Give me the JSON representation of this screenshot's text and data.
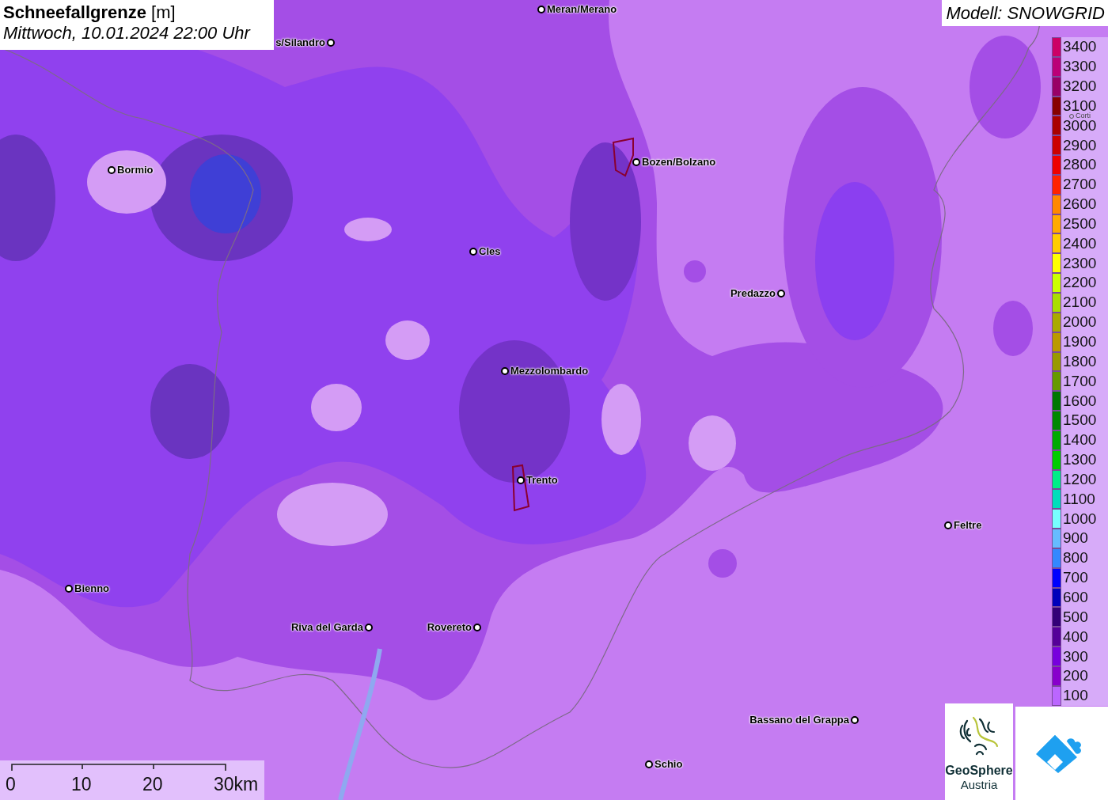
{
  "header": {
    "title": "Schneefallgrenze",
    "unit": "[m]",
    "datetime": "Mittwoch, 10.01.2024 22:00 Uhr"
  },
  "model": "Modell: SNOWGRID",
  "cities": [
    {
      "name": "Meran/Merano",
      "dimmed": false
    },
    {
      "name": "s/Silandro",
      "dimmed": false
    },
    {
      "name": "Bormio",
      "dimmed": false
    },
    {
      "name": "Bozen/Bolzano",
      "dimmed": false
    },
    {
      "name": "Cles",
      "dimmed": false
    },
    {
      "name": "Predazzo",
      "dimmed": false
    },
    {
      "name": "Mezzolombardo",
      "dimmed": false
    },
    {
      "name": "Trento",
      "dimmed": false
    },
    {
      "name": "Feltre",
      "dimmed": false
    },
    {
      "name": "Bienno",
      "dimmed": false
    },
    {
      "name": "Riva del Garda",
      "dimmed": false
    },
    {
      "name": "Rovereto",
      "dimmed": false
    },
    {
      "name": "Bassano del Grappa",
      "dimmed": false
    },
    {
      "name": "Schio",
      "dimmed": false
    },
    {
      "name": "Corti",
      "dimmed": true
    }
  ],
  "legend": [
    {
      "label": "3400",
      "color": "#cc0066"
    },
    {
      "label": "3300",
      "color": "#bb0077"
    },
    {
      "label": "3200",
      "color": "#990066"
    },
    {
      "label": "3100",
      "color": "#880000"
    },
    {
      "label": "3000",
      "color": "#aa0000"
    },
    {
      "label": "2900",
      "color": "#cc0000"
    },
    {
      "label": "2800",
      "color": "#ee0000"
    },
    {
      "label": "2700",
      "color": "#ff2200"
    },
    {
      "label": "2600",
      "color": "#ff8800"
    },
    {
      "label": "2500",
      "color": "#ffaa00"
    },
    {
      "label": "2400",
      "color": "#ffcc00"
    },
    {
      "label": "2300",
      "color": "#ffff00"
    },
    {
      "label": "2200",
      "color": "#ccff00"
    },
    {
      "label": "2100",
      "color": "#aadd00"
    },
    {
      "label": "2000",
      "color": "#aaaa00"
    },
    {
      "label": "1900",
      "color": "#bb9900"
    },
    {
      "label": "1800",
      "color": "#999900"
    },
    {
      "label": "1700",
      "color": "#669900"
    },
    {
      "label": "1600",
      "color": "#007700"
    },
    {
      "label": "1500",
      "color": "#008800"
    },
    {
      "label": "1400",
      "color": "#00aa00"
    },
    {
      "label": "1300",
      "color": "#00cc00"
    },
    {
      "label": "1200",
      "color": "#00ee88"
    },
    {
      "label": "1100",
      "color": "#00ddbb"
    },
    {
      "label": "1000",
      "color": "#77ffff"
    },
    {
      "label": "900",
      "color": "#66bbff"
    },
    {
      "label": "800",
      "color": "#3388ff"
    },
    {
      "label": "700",
      "color": "#0000ff"
    },
    {
      "label": "600",
      "color": "#0000bb"
    },
    {
      "label": "500",
      "color": "#330077"
    },
    {
      "label": "400",
      "color": "#550099"
    },
    {
      "label": "300",
      "color": "#7700dd"
    },
    {
      "label": "200",
      "color": "#8800cc"
    },
    {
      "label": "100",
      "color": "#bb66ff"
    }
  ],
  "scale": [
    "0",
    "10",
    "20",
    "30km"
  ],
  "logo": {
    "name": "GeoSphere",
    "sub": "Austria"
  }
}
